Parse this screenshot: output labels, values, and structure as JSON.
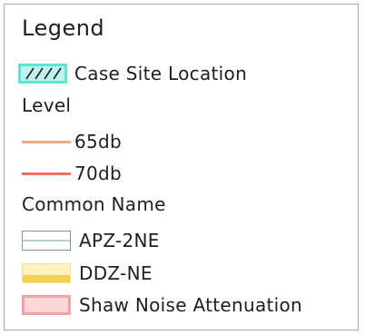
{
  "legend": {
    "title": "Legend",
    "case_site": {
      "label": "Case Site Location",
      "colors": {
        "border": "#5ce6d6",
        "fill": "#bff3ec",
        "hatch": "#1f1f1f"
      }
    },
    "level": {
      "heading": "Level",
      "items": [
        {
          "label": "65db",
          "color": "#f2a98a"
        },
        {
          "label": "70db",
          "color": "#ec7061"
        }
      ]
    },
    "common_name": {
      "heading": "Common Name",
      "items": [
        {
          "label": "APZ-2NE",
          "colors": {
            "border": "#7c9c90",
            "line": "#b9cec6"
          }
        },
        {
          "label": "DDZ-NE",
          "colors": {
            "fill": "#fdf3c2",
            "band": "#f2cf55"
          }
        },
        {
          "label": "Shaw Noise Attenuation",
          "colors": {
            "border": "#f4a0a6",
            "fill": "#fcd7da"
          }
        }
      ]
    }
  }
}
